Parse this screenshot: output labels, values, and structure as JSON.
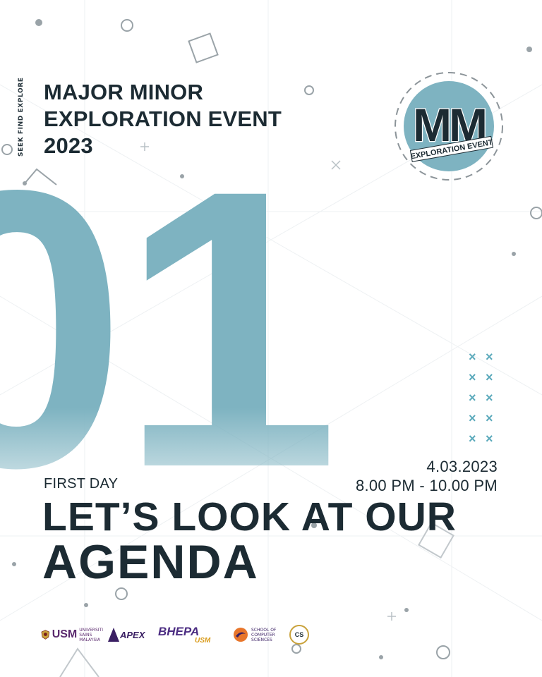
{
  "tagline": "SEEK FIND EXPLORE",
  "event_title": {
    "line1": "MAJOR MINOR",
    "line2": "EXPLORATION EVENT",
    "line3": "2023"
  },
  "logo": {
    "letters": "MM",
    "ribbon_text": "EXPLORATION EVENT"
  },
  "big_number": "01",
  "day_label": "FIRST DAY",
  "date": "4.03.2023",
  "time": "8.00 PM - 10.00 PM",
  "headline": {
    "line1": "LET’S LOOK AT OUR",
    "line2": "AGENDA"
  },
  "sponsors": {
    "usm_mark": "USM",
    "usm_text_1": "UNIVERSITI",
    "usm_text_2": "SAINS",
    "usm_text_3": "MALAYSIA",
    "apex": "APEX",
    "bhepa": "BHEPA",
    "bhepa_sub": "USM",
    "cs_line1": "SCHOOL OF",
    "cs_line2": "COMPUTER",
    "cs_line3": "SCIENCES",
    "cs_badge": "CS"
  },
  "colors": {
    "dark": "#1c2b33",
    "teal": "#7eb3c1",
    "accent": "#5aa9bb"
  }
}
